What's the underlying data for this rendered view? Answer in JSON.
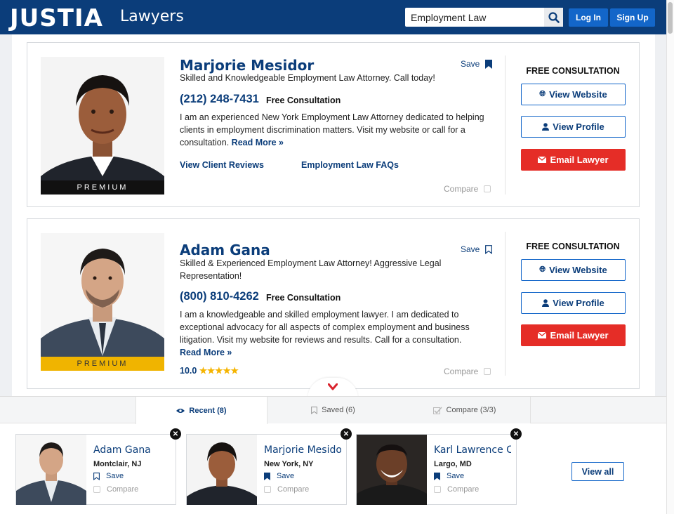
{
  "header": {
    "logo": "JUSTIA",
    "logo_sub": "Lawyers",
    "search_value": "Employment Law",
    "login_label": "Log In",
    "signup_label": "Sign Up"
  },
  "listings": [
    {
      "name": "Marjorie Mesidor",
      "tagline": "Skilled and Knowledgeable Employment Law Attorney. Call today!",
      "phone": "(212) 248-7431",
      "free_consult": "Free Consultation",
      "description": "I am an experienced New York Employment Law Attorney dedicated to helping clients in employment discrimination matters. Visit my website or call for a consultation.",
      "read_more": "Read More »",
      "link_reviews": "View Client Reviews",
      "link_faqs": "Employment Law FAQs",
      "save_label": "Save",
      "saved": true,
      "compare_label": "Compare",
      "badge": "PREMIUM",
      "badge_style": "black",
      "right_title": "FREE CONSULTATION",
      "btn_website": "View Website",
      "btn_profile": "View Profile",
      "btn_email": "Email Lawyer"
    },
    {
      "name": "Adam Gana",
      "tagline": "Skilled & Experienced Employment Law Attorney! Aggressive Legal Representation!",
      "phone": "(800) 810-4262",
      "free_consult": "Free Consultation",
      "description": "I am a knowledgeable and skilled employment lawyer. I am dedicated to exceptional advocacy for all aspects of complex employment and business litigation. Visit my website for reviews and results. Call for a consultation.",
      "read_more": "Read More »",
      "rating": "10.0",
      "stars": "★★★★★",
      "save_label": "Save",
      "saved": false,
      "compare_label": "Compare",
      "badge": "PREMIUM",
      "badge_style": "gold",
      "right_title": "FREE CONSULTATION",
      "btn_website": "View Website",
      "btn_profile": "View Profile",
      "btn_email": "Email Lawyer"
    }
  ],
  "tray": {
    "tabs": [
      {
        "label": "Recent (8)",
        "active": true
      },
      {
        "label": "Saved (6)",
        "active": false
      },
      {
        "label": "Compare (3/3)",
        "active": false
      }
    ],
    "items": [
      {
        "name": "Adam Gana",
        "location": "Montclair, NJ",
        "save_label": "Save",
        "saved": false,
        "compare_label": "Compare"
      },
      {
        "name": "Marjorie Mesidor",
        "location": "New York, NY",
        "save_label": "Save",
        "saved": true,
        "compare_label": "Compare"
      },
      {
        "name": "Karl Lawrence Ch",
        "location": "Largo, MD",
        "save_label": "Save",
        "saved": true,
        "compare_label": "Compare"
      }
    ],
    "view_all": "View all"
  },
  "colors": {
    "brand_blue": "#0b3d7a",
    "button_blue": "#1366c9",
    "email_red": "#e52d27",
    "gold": "#f0b400"
  }
}
